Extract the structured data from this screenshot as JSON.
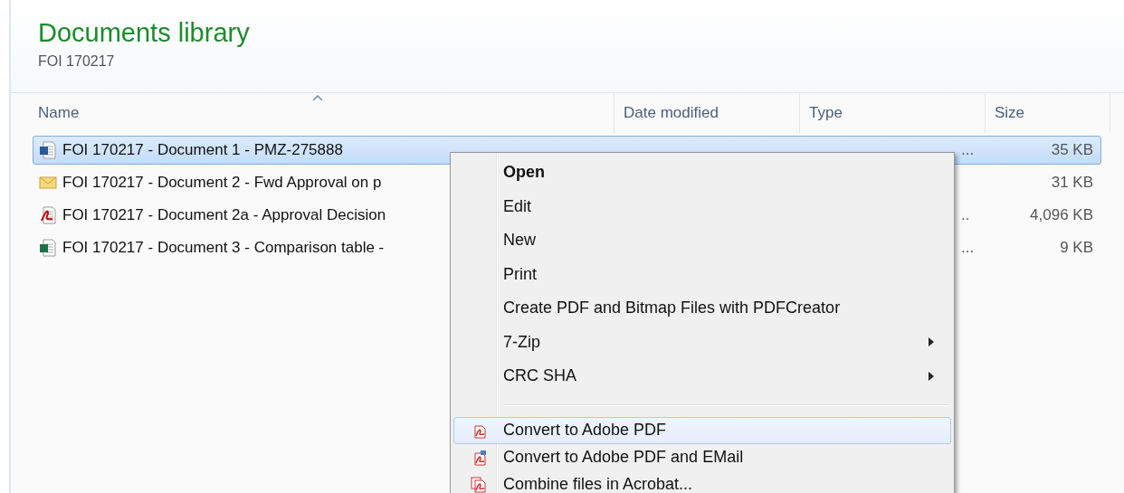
{
  "library": {
    "title": "Documents library",
    "subtitle": "FOI 170217"
  },
  "columns": [
    {
      "label": "Name",
      "sorted": true
    },
    {
      "label": "Date modified",
      "sorted": false
    },
    {
      "label": "Type",
      "sorted": false
    },
    {
      "label": "Size",
      "sorted": false
    }
  ],
  "rows": [
    {
      "kind": "word",
      "name": "FOI 170217 - Document 1 - PMZ-275888",
      "type_tail": "...",
      "size": "35 KB",
      "selected": true
    },
    {
      "kind": "mail",
      "name": "FOI 170217 - Document 2 - Fwd Approval on p",
      "size": "31 KB",
      "selected": false
    },
    {
      "kind": "pdf",
      "name": "FOI 170217 - Document 2a - Approval Decision",
      "type_tail": "..",
      "size": "4,096 KB",
      "selected": false
    },
    {
      "kind": "excel",
      "name": "FOI 170217 - Document 3 - Comparison table -",
      "type_tail": "...",
      "size": "9 KB",
      "selected": false
    }
  ],
  "context_menu": [
    {
      "label": "Open",
      "bold": true,
      "submenu": false,
      "selected": false
    },
    {
      "label": "Edit",
      "bold": false,
      "submenu": false,
      "selected": false
    },
    {
      "label": "New",
      "bold": false,
      "submenu": false,
      "selected": false
    },
    {
      "label": "Print",
      "bold": false,
      "submenu": false,
      "selected": false
    },
    {
      "label": "Create PDF and Bitmap Files with PDFCreator",
      "bold": false,
      "submenu": false,
      "selected": false
    },
    {
      "label": "7-Zip",
      "bold": false,
      "submenu": true,
      "selected": false
    },
    {
      "label": "CRC SHA",
      "bold": false,
      "submenu": true,
      "selected": false
    },
    {
      "kind": "separator"
    },
    {
      "label": "Convert to Adobe PDF",
      "kind": "pdf",
      "bold": false,
      "submenu": false,
      "selected": true
    },
    {
      "label": "Convert to Adobe PDF and EMail",
      "kind": "pdf-mail",
      "bold": false,
      "submenu": false,
      "selected": false
    },
    {
      "label": "Combine files in Acrobat...",
      "kind": "combine",
      "bold": false,
      "submenu": false,
      "selected": false
    }
  ]
}
